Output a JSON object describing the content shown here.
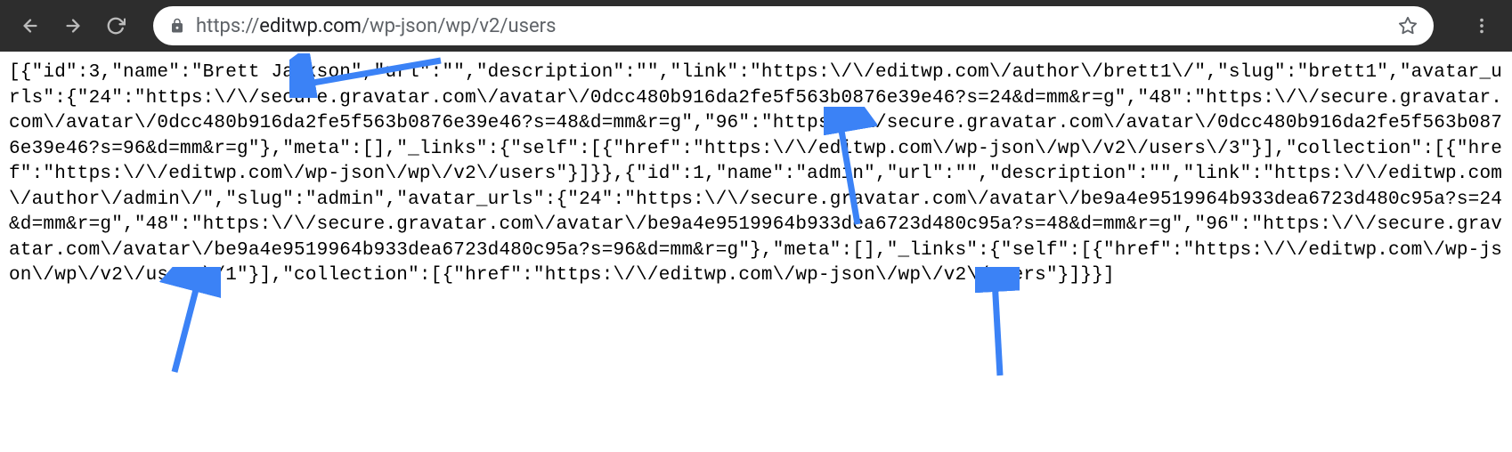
{
  "toolbar": {
    "url_protocol": "https://",
    "url_domain": "editwp.com",
    "url_path": "/wp-json/wp/v2/users"
  },
  "content": {
    "json_body": "[{\"id\":3,\"name\":\"Brett Jackson\",\"url\":\"\",\"description\":\"\",\"link\":\"https:\\/\\/editwp.com\\/author\\/brett1\\/\",\"slug\":\"brett1\",\"avatar_urls\":{\"24\":\"https:\\/\\/secure.gravatar.com\\/avatar\\/0dcc480b916da2fe5f563b0876e39e46?s=24&d=mm&r=g\",\"48\":\"https:\\/\\/secure.gravatar.com\\/avatar\\/0dcc480b916da2fe5f563b0876e39e46?s=48&d=mm&r=g\",\"96\":\"https:\\/\\/secure.gravatar.com\\/avatar\\/0dcc480b916da2fe5f563b0876e39e46?s=96&d=mm&r=g\"},\"meta\":[],\"_links\":{\"self\":[{\"href\":\"https:\\/\\/editwp.com\\/wp-json\\/wp\\/v2\\/users\\/3\"}],\"collection\":[{\"href\":\"https:\\/\\/editwp.com\\/wp-json\\/wp\\/v2\\/users\"}]}},{\"id\":1,\"name\":\"admin\",\"url\":\"\",\"description\":\"\",\"link\":\"https:\\/\\/editwp.com\\/author\\/admin\\/\",\"slug\":\"admin\",\"avatar_urls\":{\"24\":\"https:\\/\\/secure.gravatar.com\\/avatar\\/be9a4e9519964b933dea6723d480c95a?s=24&d=mm&r=g\",\"48\":\"https:\\/\\/secure.gravatar.com\\/avatar\\/be9a4e9519964b933dea6723d480c95a?s=48&d=mm&r=g\",\"96\":\"https:\\/\\/secure.gravatar.com\\/avatar\\/be9a4e9519964b933dea6723d480c95a?s=96&d=mm&r=g\"},\"meta\":[],\"_links\":{\"self\":[{\"href\":\"https:\\/\\/editwp.com\\/wp-json\\/wp\\/v2\\/users\\/1\"}],\"collection\":[{\"href\":\"https:\\/\\/editwp.com\\/wp-json\\/wp\\/v2\\/users\"}]}}]"
  },
  "annotations": {
    "arrow_color": "#3b82f6"
  }
}
